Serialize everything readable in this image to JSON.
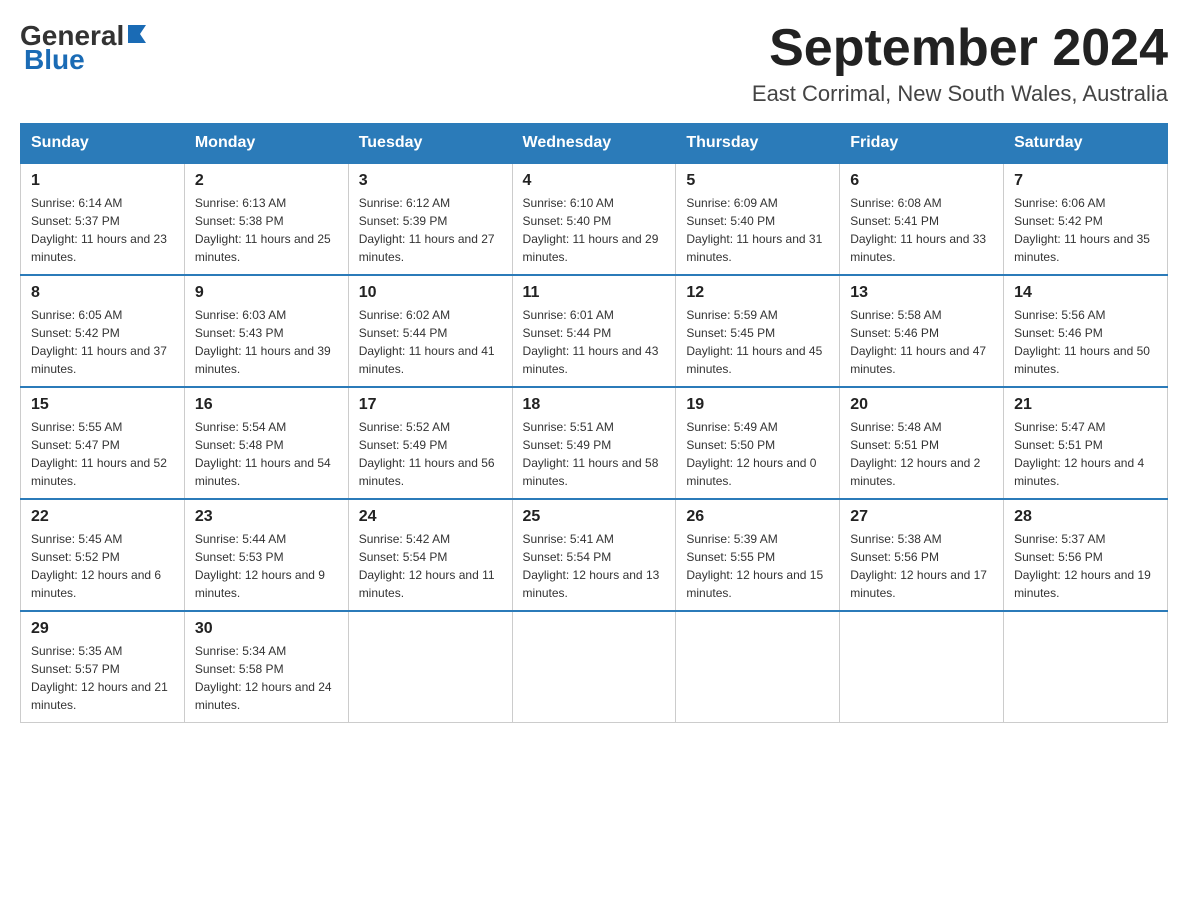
{
  "logo": {
    "general": "General",
    "blue": "Blue"
  },
  "title": {
    "month_year": "September 2024",
    "location": "East Corrimal, New South Wales, Australia"
  },
  "days_of_week": [
    "Sunday",
    "Monday",
    "Tuesday",
    "Wednesday",
    "Thursday",
    "Friday",
    "Saturday"
  ],
  "weeks": [
    [
      {
        "day": "1",
        "sunrise": "Sunrise: 6:14 AM",
        "sunset": "Sunset: 5:37 PM",
        "daylight": "Daylight: 11 hours and 23 minutes."
      },
      {
        "day": "2",
        "sunrise": "Sunrise: 6:13 AM",
        "sunset": "Sunset: 5:38 PM",
        "daylight": "Daylight: 11 hours and 25 minutes."
      },
      {
        "day": "3",
        "sunrise": "Sunrise: 6:12 AM",
        "sunset": "Sunset: 5:39 PM",
        "daylight": "Daylight: 11 hours and 27 minutes."
      },
      {
        "day": "4",
        "sunrise": "Sunrise: 6:10 AM",
        "sunset": "Sunset: 5:40 PM",
        "daylight": "Daylight: 11 hours and 29 minutes."
      },
      {
        "day": "5",
        "sunrise": "Sunrise: 6:09 AM",
        "sunset": "Sunset: 5:40 PM",
        "daylight": "Daylight: 11 hours and 31 minutes."
      },
      {
        "day": "6",
        "sunrise": "Sunrise: 6:08 AM",
        "sunset": "Sunset: 5:41 PM",
        "daylight": "Daylight: 11 hours and 33 minutes."
      },
      {
        "day": "7",
        "sunrise": "Sunrise: 6:06 AM",
        "sunset": "Sunset: 5:42 PM",
        "daylight": "Daylight: 11 hours and 35 minutes."
      }
    ],
    [
      {
        "day": "8",
        "sunrise": "Sunrise: 6:05 AM",
        "sunset": "Sunset: 5:42 PM",
        "daylight": "Daylight: 11 hours and 37 minutes."
      },
      {
        "day": "9",
        "sunrise": "Sunrise: 6:03 AM",
        "sunset": "Sunset: 5:43 PM",
        "daylight": "Daylight: 11 hours and 39 minutes."
      },
      {
        "day": "10",
        "sunrise": "Sunrise: 6:02 AM",
        "sunset": "Sunset: 5:44 PM",
        "daylight": "Daylight: 11 hours and 41 minutes."
      },
      {
        "day": "11",
        "sunrise": "Sunrise: 6:01 AM",
        "sunset": "Sunset: 5:44 PM",
        "daylight": "Daylight: 11 hours and 43 minutes."
      },
      {
        "day": "12",
        "sunrise": "Sunrise: 5:59 AM",
        "sunset": "Sunset: 5:45 PM",
        "daylight": "Daylight: 11 hours and 45 minutes."
      },
      {
        "day": "13",
        "sunrise": "Sunrise: 5:58 AM",
        "sunset": "Sunset: 5:46 PM",
        "daylight": "Daylight: 11 hours and 47 minutes."
      },
      {
        "day": "14",
        "sunrise": "Sunrise: 5:56 AM",
        "sunset": "Sunset: 5:46 PM",
        "daylight": "Daylight: 11 hours and 50 minutes."
      }
    ],
    [
      {
        "day": "15",
        "sunrise": "Sunrise: 5:55 AM",
        "sunset": "Sunset: 5:47 PM",
        "daylight": "Daylight: 11 hours and 52 minutes."
      },
      {
        "day": "16",
        "sunrise": "Sunrise: 5:54 AM",
        "sunset": "Sunset: 5:48 PM",
        "daylight": "Daylight: 11 hours and 54 minutes."
      },
      {
        "day": "17",
        "sunrise": "Sunrise: 5:52 AM",
        "sunset": "Sunset: 5:49 PM",
        "daylight": "Daylight: 11 hours and 56 minutes."
      },
      {
        "day": "18",
        "sunrise": "Sunrise: 5:51 AM",
        "sunset": "Sunset: 5:49 PM",
        "daylight": "Daylight: 11 hours and 58 minutes."
      },
      {
        "day": "19",
        "sunrise": "Sunrise: 5:49 AM",
        "sunset": "Sunset: 5:50 PM",
        "daylight": "Daylight: 12 hours and 0 minutes."
      },
      {
        "day": "20",
        "sunrise": "Sunrise: 5:48 AM",
        "sunset": "Sunset: 5:51 PM",
        "daylight": "Daylight: 12 hours and 2 minutes."
      },
      {
        "day": "21",
        "sunrise": "Sunrise: 5:47 AM",
        "sunset": "Sunset: 5:51 PM",
        "daylight": "Daylight: 12 hours and 4 minutes."
      }
    ],
    [
      {
        "day": "22",
        "sunrise": "Sunrise: 5:45 AM",
        "sunset": "Sunset: 5:52 PM",
        "daylight": "Daylight: 12 hours and 6 minutes."
      },
      {
        "day": "23",
        "sunrise": "Sunrise: 5:44 AM",
        "sunset": "Sunset: 5:53 PM",
        "daylight": "Daylight: 12 hours and 9 minutes."
      },
      {
        "day": "24",
        "sunrise": "Sunrise: 5:42 AM",
        "sunset": "Sunset: 5:54 PM",
        "daylight": "Daylight: 12 hours and 11 minutes."
      },
      {
        "day": "25",
        "sunrise": "Sunrise: 5:41 AM",
        "sunset": "Sunset: 5:54 PM",
        "daylight": "Daylight: 12 hours and 13 minutes."
      },
      {
        "day": "26",
        "sunrise": "Sunrise: 5:39 AM",
        "sunset": "Sunset: 5:55 PM",
        "daylight": "Daylight: 12 hours and 15 minutes."
      },
      {
        "day": "27",
        "sunrise": "Sunrise: 5:38 AM",
        "sunset": "Sunset: 5:56 PM",
        "daylight": "Daylight: 12 hours and 17 minutes."
      },
      {
        "day": "28",
        "sunrise": "Sunrise: 5:37 AM",
        "sunset": "Sunset: 5:56 PM",
        "daylight": "Daylight: 12 hours and 19 minutes."
      }
    ],
    [
      {
        "day": "29",
        "sunrise": "Sunrise: 5:35 AM",
        "sunset": "Sunset: 5:57 PM",
        "daylight": "Daylight: 12 hours and 21 minutes."
      },
      {
        "day": "30",
        "sunrise": "Sunrise: 5:34 AM",
        "sunset": "Sunset: 5:58 PM",
        "daylight": "Daylight: 12 hours and 24 minutes."
      },
      null,
      null,
      null,
      null,
      null
    ]
  ]
}
